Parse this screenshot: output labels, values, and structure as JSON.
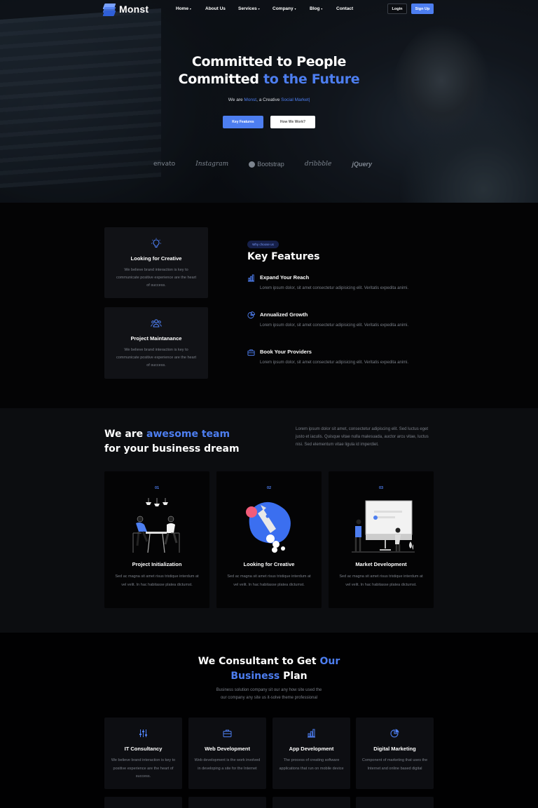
{
  "colors": {
    "accent": "#4d7ef0",
    "background": "#050506",
    "card": "#111216",
    "muted_text": "#7a7f88"
  },
  "nav": {
    "logo": "Monst",
    "items": [
      "Home",
      "About Us",
      "Services",
      "Company",
      "Blog",
      "Contact"
    ],
    "dropdown_items": [
      "Home",
      "Services",
      "Company",
      "Blog"
    ],
    "login": "Login",
    "signup": "Sign Up"
  },
  "hero": {
    "title_line1": "Committed to People",
    "title_line2_start": "Committed ",
    "title_line2_highlight": "to the Future",
    "subtitle_prefix": "We are ",
    "subtitle_brand": "Monst",
    "subtitle_middle": ", a Creative ",
    "subtitle_highlight": "Social Market",
    "btn_primary": "Key Features",
    "btn_secondary": "How We Work?",
    "brands": [
      "envato",
      "Instagram",
      "Bootstrap",
      "dribbble",
      "jQuery"
    ]
  },
  "features": {
    "cards": [
      {
        "icon": "lightbulb-icon",
        "title": "Looking for Creative",
        "text": "We believe brand interaction is key to communicate positive experience are the heart of success."
      },
      {
        "icon": "users-icon",
        "title": "Project Maintanance",
        "text": "We believe brand interaction is key to communicate positive experience are the heart of success."
      }
    ],
    "pill": "Why choose us",
    "title": "Key Features",
    "items": [
      {
        "icon": "bar-chart-icon",
        "title": "Expand Your Reach",
        "text": "Lorem ipsum dolor, sit amet consectetur adipisicing elit. Veritatis expedita animi."
      },
      {
        "icon": "pie-chart-icon",
        "title": "Annualized Growth",
        "text": "Lorem ipsum dolor, sit amet consectetur adipisicing elit. Veritatis expedita animi."
      },
      {
        "icon": "briefcase-icon",
        "title": "Book Your Providers",
        "text": "Lorem ipsum dolor, sit amet consectetur adipisicing elit. Veritatis expedita animi."
      }
    ]
  },
  "team": {
    "title_start": "We are ",
    "title_highlight": "awesome team",
    "title_line2": "for your business dream",
    "description": "Lorem ipsum dolor sit amet, consectetur adipiscing elit. Sed luctus eget justo et iaculis. Quisque vitae nulla malesuada, auctor arcu vitae, luctus nisi. Sed elementum vitae ligula id imperdiet.",
    "cards": [
      {
        "num": "01",
        "title": "Project Initialization",
        "text": "Sed ac magna sit amet risus tristique interdum at vel velit. In hac habitasse platea dictumst."
      },
      {
        "num": "02",
        "title": "Looking for Creative",
        "text": "Sed ac magna sit amet risus tristique interdum at vel velit. In hac habitasse platea dictumst."
      },
      {
        "num": "03",
        "title": "Market Development",
        "text": "Sed ac magna sit amet risus tristique interdum at vel velit. In hac habitasse platea dictumst."
      }
    ]
  },
  "consultant": {
    "title_start": "We Consultant to Get ",
    "title_highlight1": "Our",
    "title_highlight2": "Business",
    "title_end": " Plan",
    "description_line1": "Business solution company sit our any how site used the",
    "description_line2": "our company any site us it-solve theme professional",
    "services": [
      {
        "icon": "sliders-icon",
        "title": "IT Consultancy",
        "text": "We believe brand interaction is key to positive experience are the heart of success."
      },
      {
        "icon": "briefcase-icon",
        "title": "Web Development",
        "text": "Web development is the work involved in developing a site for the Internet"
      },
      {
        "icon": "bar-chart-icon",
        "title": "App Development",
        "text": "The process of creating software applications that run on mobile device"
      },
      {
        "icon": "pie-chart-icon",
        "title": "Digital Marketing",
        "text": "Component of marketing that uses the Internet and online based digital"
      }
    ]
  }
}
